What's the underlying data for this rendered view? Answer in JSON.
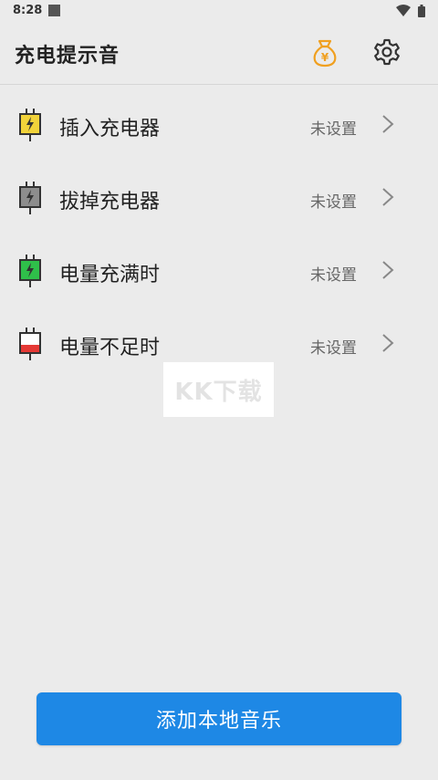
{
  "status_bar": {
    "time": "8:28"
  },
  "header": {
    "title": "充电提示音"
  },
  "list": {
    "items": [
      {
        "label": "插入充电器",
        "status": "未设置",
        "icon": "plug-yellow-icon",
        "color": "#f2d33a"
      },
      {
        "label": "拔掉充电器",
        "status": "未设置",
        "icon": "plug-gray-icon",
        "color": "#8d8d8d"
      },
      {
        "label": "电量充满时",
        "status": "未设置",
        "icon": "plug-green-icon",
        "color": "#2fbf4a"
      },
      {
        "label": "电量不足时",
        "status": "未设置",
        "icon": "plug-red-icon",
        "color": "#e53935"
      }
    ]
  },
  "watermark": {
    "text": "KK下载"
  },
  "footer": {
    "add_button_label": "添加本地音乐"
  },
  "colors": {
    "accent": "#1e88e5",
    "coin": "#f0a020"
  }
}
